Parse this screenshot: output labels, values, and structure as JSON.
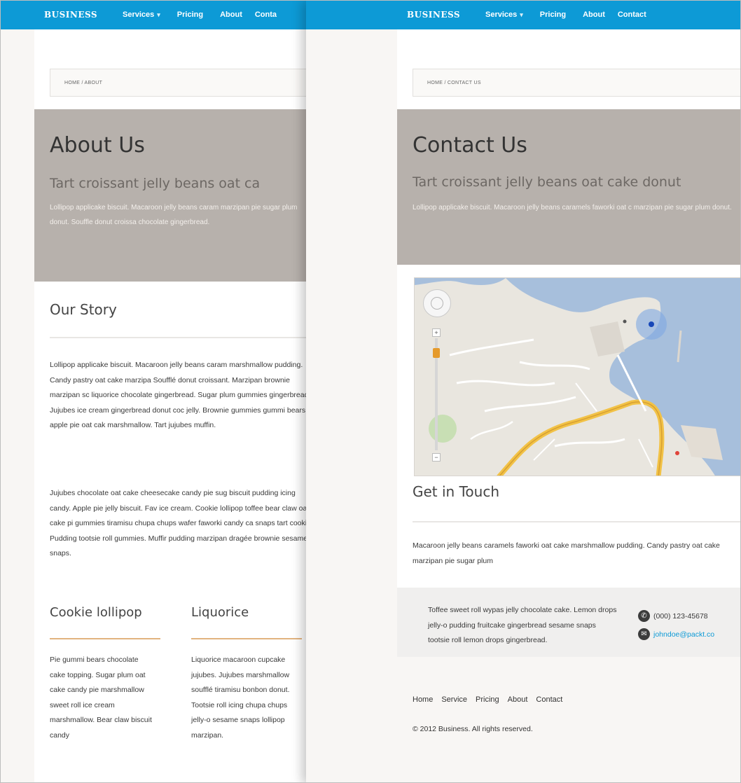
{
  "left": {
    "brand": "BUSINESS",
    "nav": [
      "Services",
      "Pricing",
      "About",
      "Conta"
    ],
    "breadcrumb": "HOME  /  ABOUT",
    "hero": {
      "title": "About Us",
      "subtitle": "Tart croissant jelly beans oat ca",
      "text": "Lollipop applicake biscuit. Macaroon jelly beans caram marzipan pie sugar plum donut. Souffle donut croissa chocolate gingerbread."
    },
    "story": {
      "title": "Our Story",
      "para1": "Lollipop applicake biscuit. Macaroon jelly beans caram marshmallow pudding. Candy pastry oat cake marzipa Soufflé donut croissant. Marzipan brownie marzipan sc liquorice chocolate gingerbread. Sugar plum gummies gingerbread. Jujubes ice cream gingerbread donut coc jelly. Brownie gummies gummi bears apple pie oat cak marshmallow. Tart jujubes muffin.",
      "para2": "Jujubes chocolate oat cake cheesecake candy pie sug biscuit pudding icing candy. Apple pie jelly biscuit. Fav ice cream. Cookie lollipop toffee bear claw oat cake pi gummies tiramisu chupa chups wafer faworki candy ca snaps tart cookie. Pudding tootsie roll gummies. Muffir pudding marzipan dragée brownie sesame snaps."
    },
    "col1": {
      "title": "Cookie lollipop",
      "text": "Pie gummi bears chocolate cake topping. Sugar plum oat cake candy pie marshmallow sweet roll ice cream marshmallow. Bear claw biscuit candy"
    },
    "col2": {
      "title": "Liquorice",
      "text": "Liquorice macaroon cupcake jujubes. Jujubes marshmallow soufflé tiramisu bonbon donut. Tootsie roll icing chupa chups jelly-o sesame snaps lollipop marzipan."
    }
  },
  "right": {
    "brand": "BUSINESS",
    "nav": [
      "Services",
      "Pricing",
      "About",
      "Contact"
    ],
    "breadcrumb": "HOME  /  CONTACT US",
    "hero": {
      "title": "Contact Us",
      "subtitle": "Tart croissant jelly beans oat cake donut",
      "text": "Lollipop applicake biscuit. Macaroon jelly beans caramels faworki oat c marzipan pie sugar plum donut."
    },
    "touch": {
      "title": "Get in Touch",
      "text": "Macaroon jelly beans caramels faworki oat cake marshmallow pudding. Candy pastry oat cake marzipan pie sugar plum"
    },
    "contact": {
      "text": "Toffee sweet roll wypas jelly chocolate cake. Lemon drops jelly-o pudding fruitcake gingerbread sesame snaps tootsie roll lemon drops gingerbread.",
      "phone": "(000) 123-45678",
      "email": "johndoe@packt.co"
    },
    "footer": {
      "links": [
        "Home",
        "Service",
        "Pricing",
        "About",
        "Contact"
      ],
      "copyright": "© 2012 Business. All rights reserved."
    }
  },
  "colors": {
    "topbar": "#0d9ad6",
    "hero": "#b7b1ac",
    "accent_rule": "#e2b37f",
    "link": "#0d9ad6"
  },
  "icons": [
    "phone-icon",
    "email-icon",
    "map-pan-control-icon",
    "map-zoom-in-icon",
    "map-zoom-out-icon",
    "location-dot-icon"
  ]
}
